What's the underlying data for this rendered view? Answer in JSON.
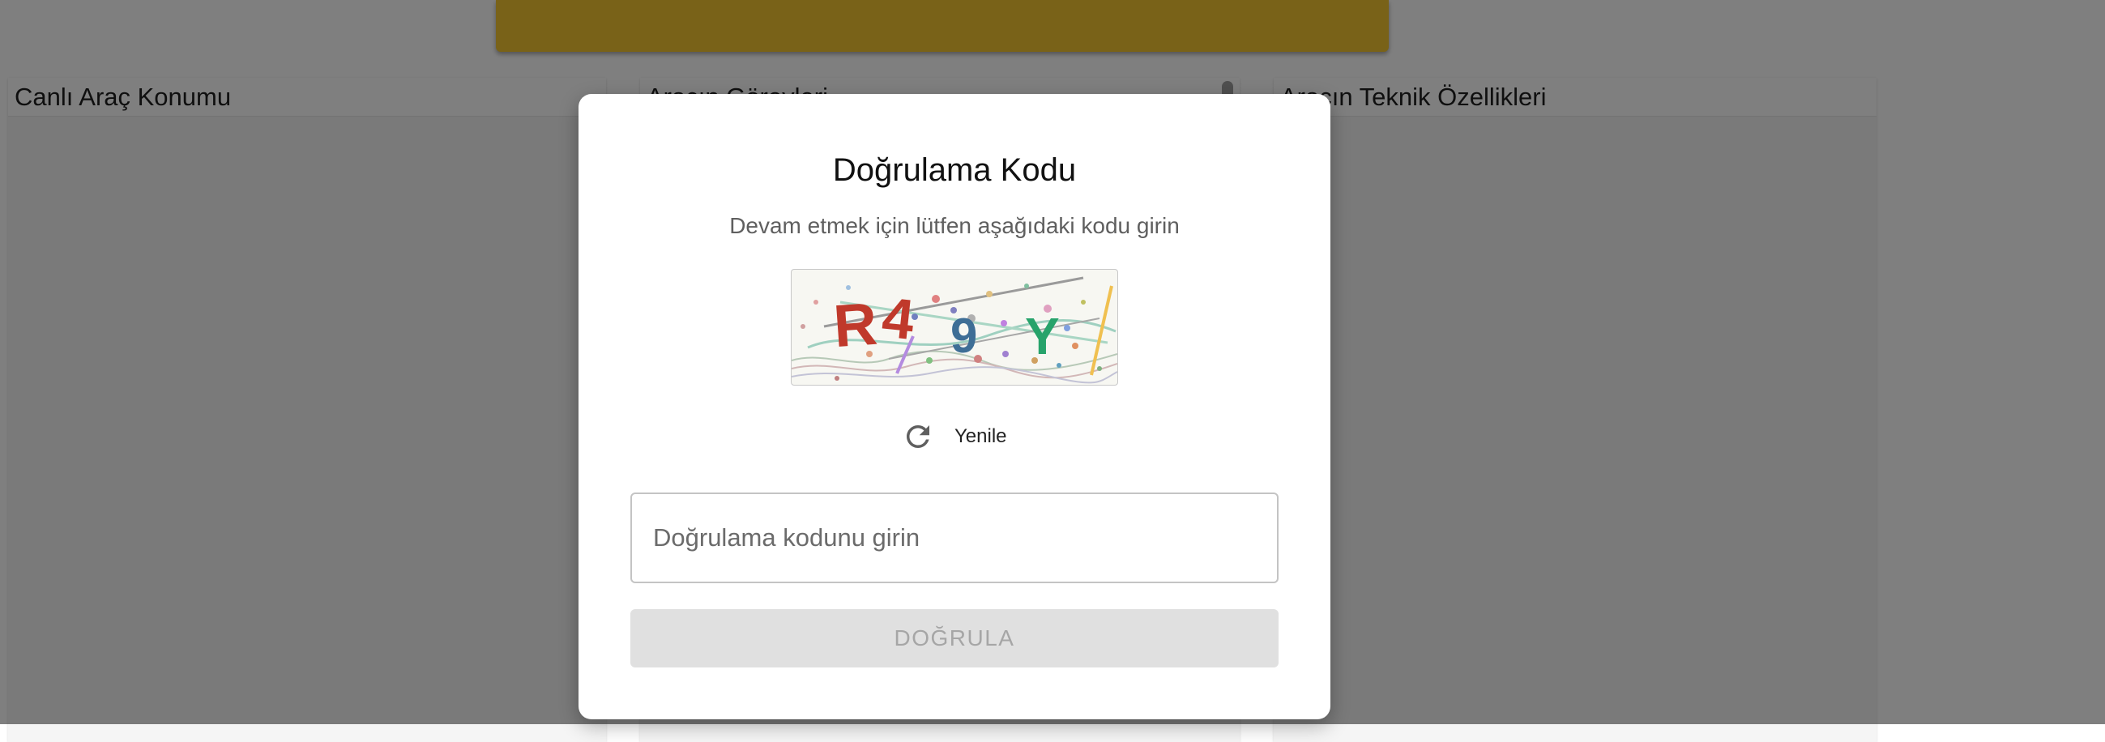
{
  "background": {
    "panels": [
      {
        "title": "Canlı Araç Konumu"
      },
      {
        "title": "Aracın Görevleri"
      },
      {
        "title": "Aracın Teknik Özellikleri"
      }
    ],
    "banner_color": "#f2c530"
  },
  "modal": {
    "title": "Doğrulama Kodu",
    "subtitle": "Devam etmek için lütfen aşağıdaki kodu girin",
    "captcha": {
      "characters": [
        "R",
        "4",
        "9",
        "Y"
      ]
    },
    "refresh_label": "Yenile",
    "input": {
      "placeholder": "Doğrulama kodunu girin",
      "value": ""
    },
    "verify_label": "DOĞRULA",
    "verify_disabled": true
  },
  "icons": {
    "refresh": "refresh-icon"
  }
}
